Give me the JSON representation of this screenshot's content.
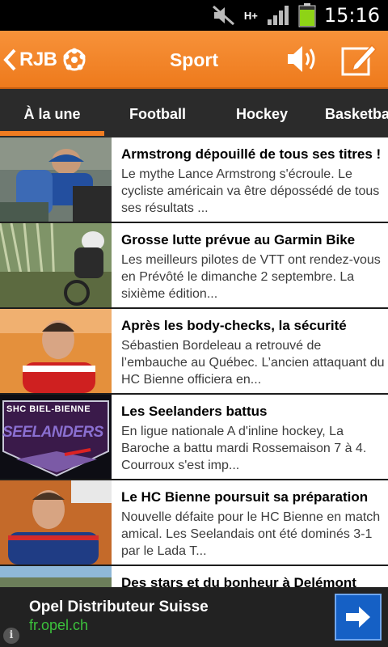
{
  "status_bar": {
    "network": "H+",
    "time": "15:16"
  },
  "app_bar": {
    "logo": "RJB",
    "title": "Sport"
  },
  "tabs": [
    {
      "label": "À la une",
      "active": true
    },
    {
      "label": "Football",
      "active": false
    },
    {
      "label": "Hockey",
      "active": false
    },
    {
      "label": "Basketball",
      "active": false
    }
  ],
  "articles": [
    {
      "title": "Armstrong dépouillé de tous ses titres !",
      "summary": "Le mythe Lance Armstrong s'écroule. Le cycliste américain va être dépossédé de tous ses résultats ..."
    },
    {
      "title": "Grosse lutte prévue au Garmin Bike",
      "summary": "Les meilleurs pilotes de VTT ont rendez-vous en Prévôté le dimanche 2 septembre. La sixième édition..."
    },
    {
      "title": "Après les body-checks, la sécurité",
      "summary": "Sébastien Bordeleau a retrouvé de l’embauche au Québec. L’ancien attaquant du HC Bienne officiera en..."
    },
    {
      "title": "Les Seelanders battus",
      "summary": "En ligue nationale A d'inline hockey, La Baroche a battu mardi Rossemaison 7 à 4. Courroux s'est imp...",
      "thumb_text": {
        "top": "SHC BIEL-BIENNE",
        "main": "SEELANDERS"
      }
    },
    {
      "title": "Le HC Bienne poursuit sa préparation",
      "summary": "Nouvelle défaite pour le HC Bienne en match amical. Les Seelandais ont été dominés 3-1 par le Lada T..."
    },
    {
      "title": "Des stars et du bonheur à Delémont",
      "summary": ""
    }
  ],
  "ad": {
    "title": "Opel Distributeur Suisse",
    "url": "fr.opel.ch"
  },
  "colors": {
    "accent": "#f07d22",
    "tabbar": "#2b2b2b",
    "ad_button": "#1560c5",
    "ad_url": "#3cc13c"
  }
}
